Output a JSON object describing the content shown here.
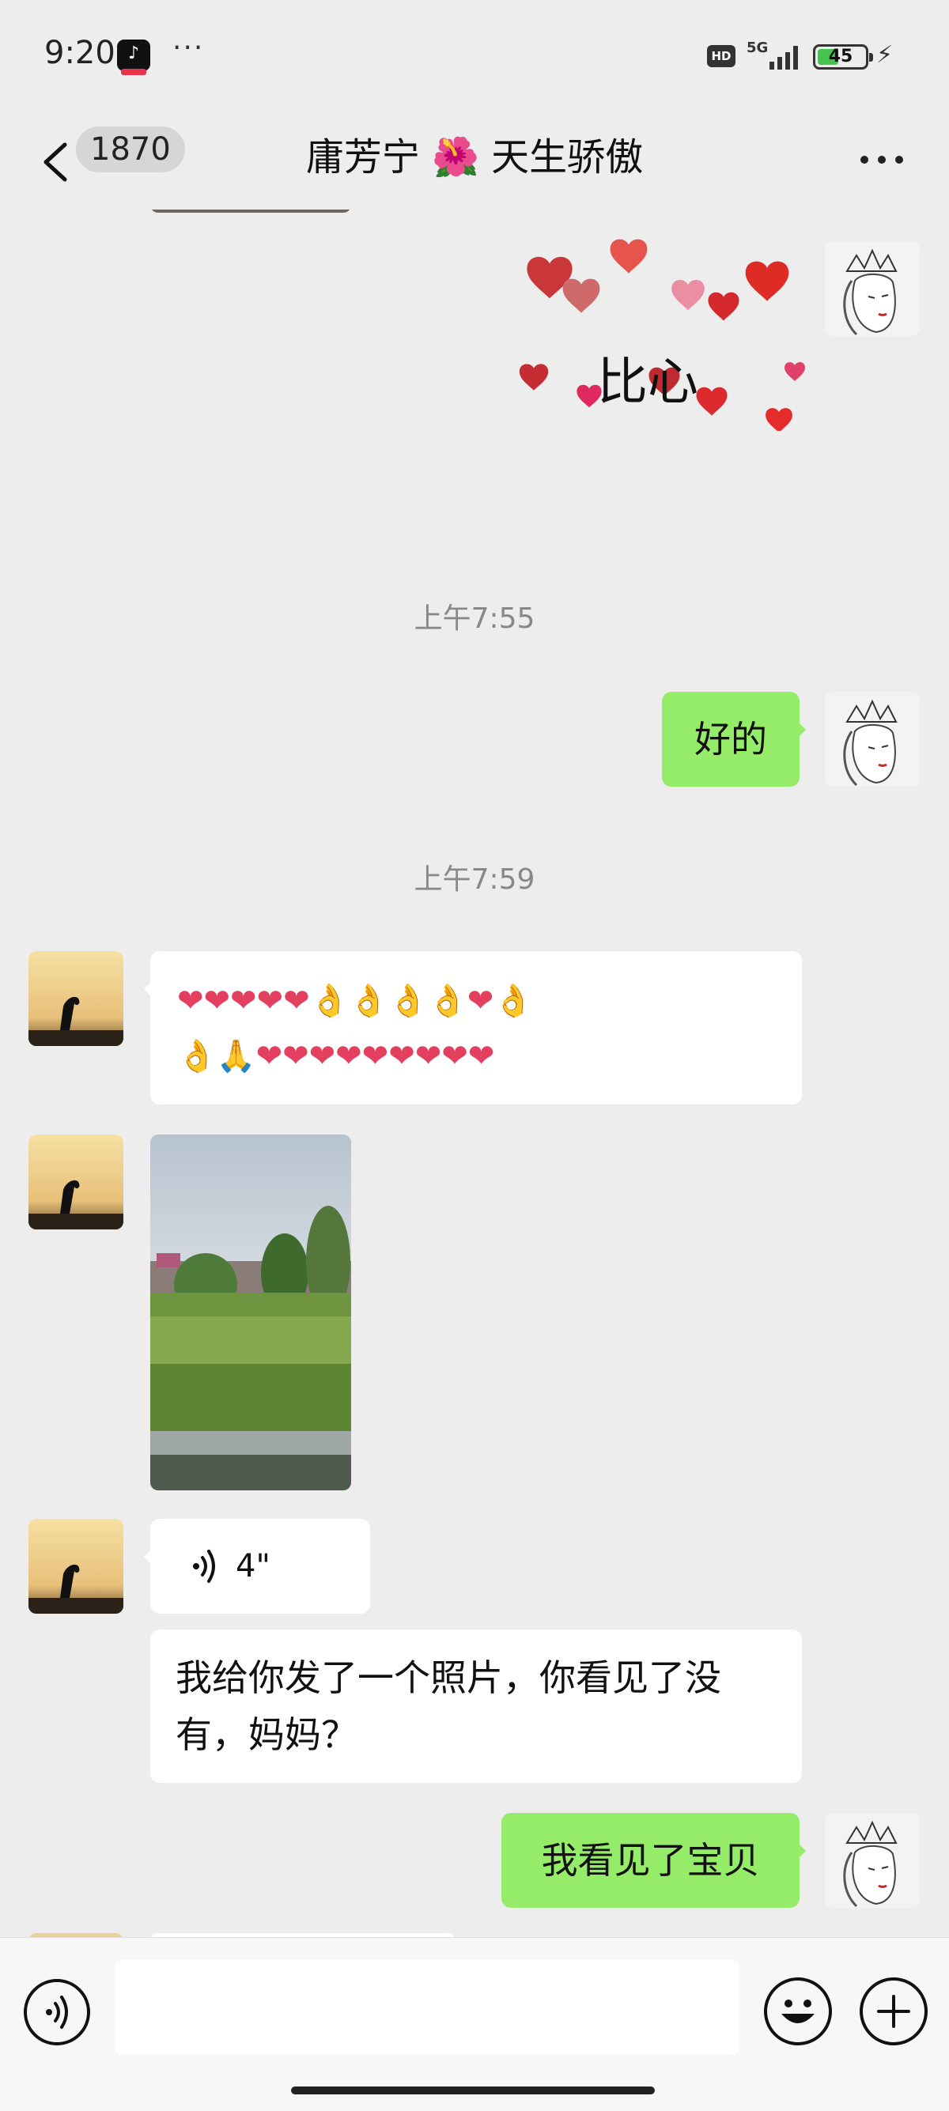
{
  "status_bar": {
    "time": "9:20",
    "notification_dots": "···",
    "hd": "HD",
    "network": "5G",
    "battery": "45",
    "battery_level": 0.45
  },
  "header": {
    "back_count": "1870",
    "title": "庸芳宁 🌺 天生骄傲"
  },
  "messages": {
    "sticker_text": "比心",
    "time_1": "上午7:55",
    "reply_1": "好的",
    "time_2": "上午7:59",
    "emoji_line_1": "❤❤❤❤❤👌👌👌👌❤👌",
    "emoji_line_2": "👌🙏❤❤❤❤❤❤❤❤❤",
    "voice_duration": "4\"",
    "text_1": "我给你发了一个照片，你看见了没有，妈妈？",
    "reply_2": "我看见了宝贝"
  },
  "icons": {
    "back": "chevron-left-icon",
    "more": "more-dots-icon",
    "voice": "voice-wave-icon",
    "emoji": "smiley-icon",
    "plus": "plus-circle-icon"
  },
  "colors": {
    "outgoing_bubble": "#95ec69",
    "incoming_bubble": "#ffffff",
    "background": "#ededed"
  }
}
